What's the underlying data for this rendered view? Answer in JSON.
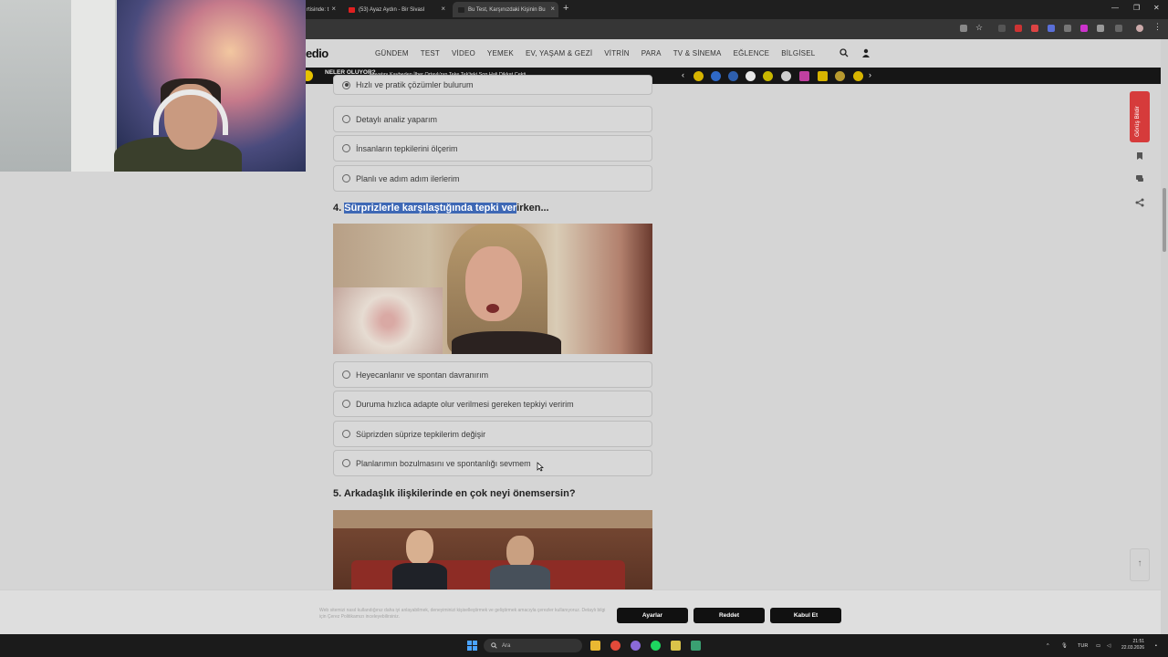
{
  "browser": {
    "tabs": [
      {
        "label": "rtisinde: t"
      },
      {
        "label": "(53) Ayaz Aydın - Bir Sivasl"
      },
      {
        "label": "Bu Test, Karşınızdaki Kişinin Bu"
      }
    ]
  },
  "site": {
    "logo": "edio",
    "nav": [
      "GÜNDEM",
      "TEST",
      "VİDEO",
      "YEMEK",
      "EV, YAŞAM & GEZİ",
      "VİTRİN",
      "PARA",
      "TV & SİNEMA",
      "EĞLENCE",
      "BİLGİSEL"
    ],
    "feedback_label": "Görüş Bildir"
  },
  "ticker": {
    "heading": "NELER OLUYOR?",
    "headline": "Hayatını Kaybeden İlber Ortaylı'nın Teke Tek'teki Son Hali Dikkat Çekti"
  },
  "quiz": {
    "q3": {
      "options": [
        "Hızlı ve pratik çözümler bulurum",
        "Detaylı analiz yaparım",
        "İnsanların tepkilerini ölçerim",
        "Planlı ve adım adım ilerlerim"
      ],
      "selected_index": 0
    },
    "q4": {
      "number": "4. ",
      "title_selected": "Sürprizlerle karşılaştığında tepki ver",
      "title_rest": "irken...",
      "options": [
        "Heyecanlanır ve spontan davranırım",
        "Duruma hızlıca adapte olur verilmesi gereken tepkiyi veririm",
        "Süprizden süprize tepkilerim değişir",
        "Planlarımın bozulmasını ve spontanlığı sevmem"
      ]
    },
    "q5": {
      "number": "5. ",
      "title": "Arkadaşlık ilişkilerinde en çok neyi önemsersin?"
    }
  },
  "cookie": {
    "text": "Web sitemizi nasıl kullandığınız daha iyi anlayabilmek, deneyiminizi kişiselleştirmek ve geliştirmek amacıyla çerezler kullanıyoruz. Detaylı bilgi için Çerez Politikamızı inceleyebilirsiniz.",
    "settings_label": "Ayarlar",
    "reject_label": "Reddet",
    "accept_label": "Kabul Et"
  },
  "taskbar": {
    "search_placeholder": "Ara",
    "language": "TUR",
    "time": "21:51",
    "date": "22.03.2026"
  }
}
